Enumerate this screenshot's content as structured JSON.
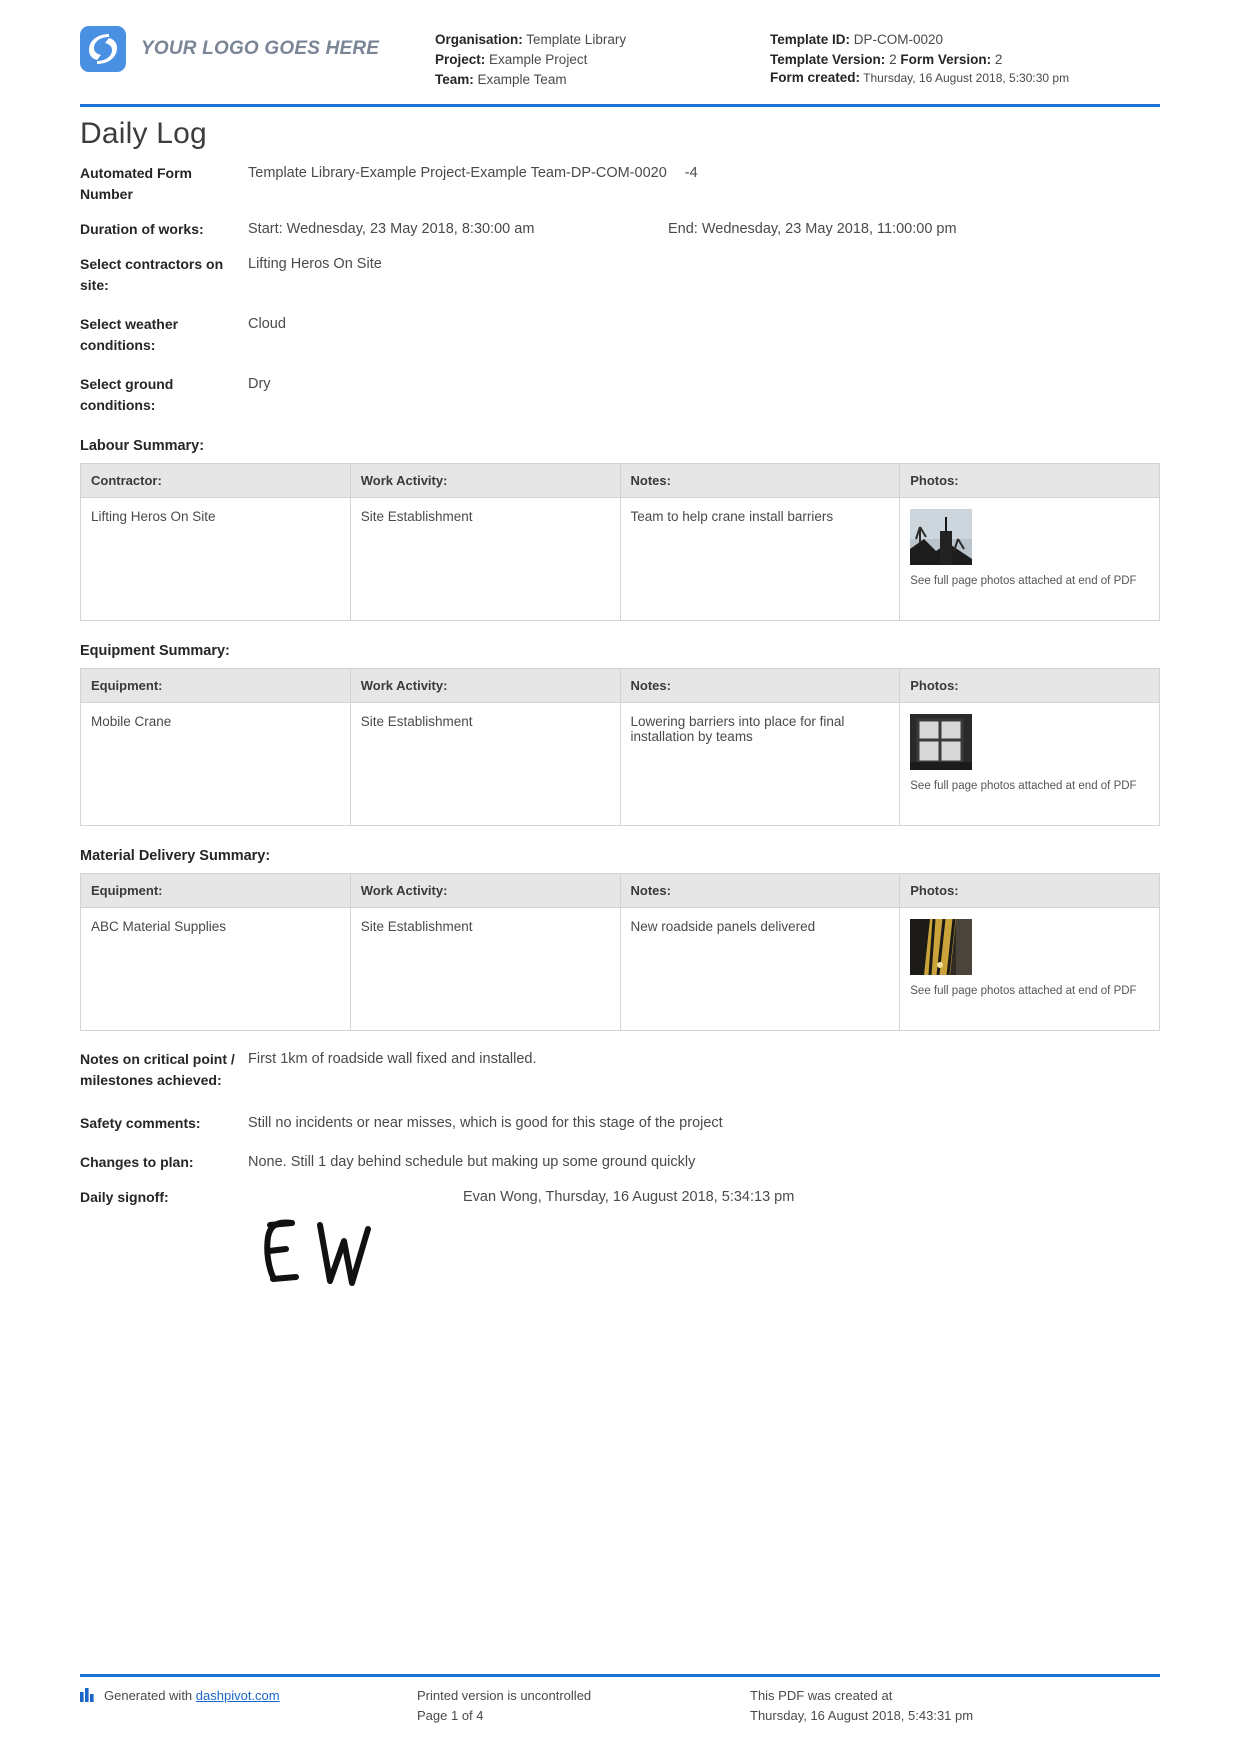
{
  "header": {
    "logo_text": "YOUR LOGO GOES HERE",
    "logo_color": "#4a90e2",
    "accent_color": "#1a73d4",
    "organisation_label": "Organisation:",
    "organisation_value": "Template Library",
    "project_label": "Project:",
    "project_value": "Example Project",
    "team_label": "Team:",
    "team_value": "Example Team",
    "template_id_label": "Template ID:",
    "template_id_value": "DP-COM-0020",
    "template_version_label": "Template Version:",
    "template_version_value": "2",
    "form_version_label": "Form Version:",
    "form_version_value": "2",
    "form_created_label": "Form created:",
    "form_created_value": "Thursday, 16 August 2018, 5:30:30 pm"
  },
  "title": "Daily Log",
  "fields": {
    "automated_form_number_label": "Automated Form Number",
    "automated_form_number_value": "Template Library-Example Project-Example Team-DP-COM-0020",
    "automated_form_number_suffix": "-4",
    "duration_label": "Duration of works:",
    "duration_start": "Start: Wednesday, 23 May 2018, 8:30:00 am",
    "duration_end": "End: Wednesday, 23 May 2018, 11:00:00 pm",
    "contractors_label": "Select contractors on site:",
    "contractors_value": "Lifting Heros On Site",
    "weather_label": "Select weather conditions:",
    "weather_value": "Cloud",
    "ground_label": "Select ground conditions:",
    "ground_value": "Dry"
  },
  "labour_summary": {
    "title": "Labour Summary:",
    "columns": [
      "Contractor:",
      "Work Activity:",
      "Notes:",
      "Photos:"
    ],
    "rows": [
      {
        "contractor": "Lifting Heros On Site",
        "work_activity": "Site Establishment",
        "notes": "Team to help crane install barriers",
        "photo_caption": "See full page photos attached at end of PDF"
      }
    ]
  },
  "equipment_summary": {
    "title": "Equipment Summary:",
    "columns": [
      "Equipment:",
      "Work Activity:",
      "Notes:",
      "Photos:"
    ],
    "rows": [
      {
        "equipment": "Mobile Crane",
        "work_activity": "Site Establishment",
        "notes": "Lowering barriers into place for final installation by teams",
        "photo_caption": "See full page photos attached at end of PDF"
      }
    ]
  },
  "material_delivery_summary": {
    "title": "Material Delivery Summary:",
    "columns": [
      "Equipment:",
      "Work Activity:",
      "Notes:",
      "Photos:"
    ],
    "rows": [
      {
        "equipment": "ABC Material Supplies",
        "work_activity": "Site Establishment",
        "notes": "New roadside panels delivered",
        "photo_caption": "See full page photos attached at end of PDF"
      }
    ]
  },
  "closing": {
    "notes_label": "Notes on critical point / milestones achieved:",
    "notes_value": "First 1km of roadside wall fixed and installed.",
    "safety_label": "Safety comments:",
    "safety_value": "Still no incidents or near misses, which is good for this stage of the project",
    "changes_label": "Changes to plan:",
    "changes_value": "None. Still 1 day behind schedule but making up some ground quickly",
    "signoff_label": "Daily signoff:",
    "signoff_name": "Evan Wong, Thursday, 16 August 2018, 5:34:13 pm",
    "signature_initials": "E W"
  },
  "footer": {
    "generated_prefix": "Generated with",
    "generated_link": "dashpivot.com",
    "uncontrolled": "Printed version is uncontrolled",
    "page": "Page 1 of 4",
    "created_at_label": "This PDF was created at",
    "created_at_value": "Thursday, 16 August 2018, 5:43:31 pm"
  }
}
